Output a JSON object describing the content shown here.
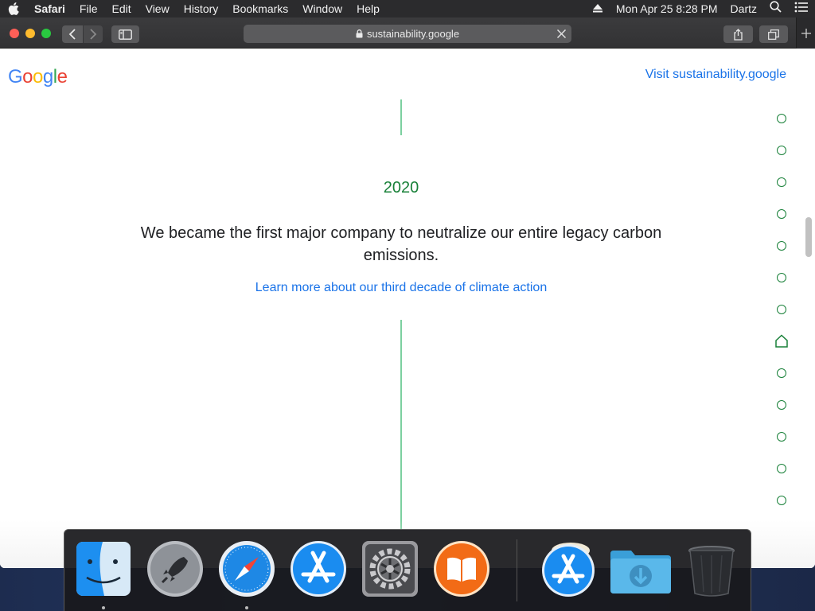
{
  "menubar": {
    "app_name": "Safari",
    "menus": [
      "File",
      "Edit",
      "View",
      "History",
      "Bookmarks",
      "Window",
      "Help"
    ],
    "datetime": "Mon Apr 25  8:28 PM",
    "user": "Dartz",
    "icons": [
      "apple-icon",
      "eject-icon",
      "spotlight-search-icon",
      "notification-center-icon"
    ]
  },
  "browser": {
    "url": "sustainability.google",
    "colors": {
      "toolbar": "#333335",
      "address_bar": "#5b5b5d"
    }
  },
  "page": {
    "logo": {
      "G": "G",
      "o1": "o",
      "o2": "o",
      "g": "g",
      "l": "l",
      "e": "e"
    },
    "visit_link": "Visit sustainability.google",
    "year": "2020",
    "headline": "We became the first major company to neutralize our entire legacy carbon emissions.",
    "learn_link": "Learn more about our third decade of climate action",
    "timeline_marker_count": 13,
    "timeline_active_index": 7,
    "colors": {
      "accent_green": "#188038",
      "link_blue": "#1a73e8",
      "line": "#7cd0a0"
    }
  },
  "dock": {
    "apps": [
      {
        "name": "finder-icon",
        "running": true
      },
      {
        "name": "launchpad-icon",
        "running": false
      },
      {
        "name": "safari-icon",
        "running": true
      },
      {
        "name": "app-store-icon",
        "running": false
      },
      {
        "name": "system-preferences-icon",
        "running": false
      },
      {
        "name": "books-icon",
        "running": false
      }
    ],
    "others": [
      {
        "name": "app-store-installer-icon"
      },
      {
        "name": "downloads-folder-icon"
      },
      {
        "name": "trash-icon"
      }
    ]
  }
}
